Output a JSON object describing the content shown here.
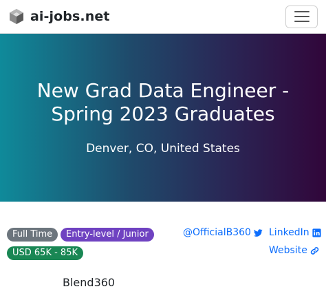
{
  "navbar": {
    "brand": "ai-jobs.net",
    "menu_icon": "hamburger-icon"
  },
  "hero": {
    "title": "New Grad Data Engineer - Spring 2023 Graduates",
    "location": "Denver, CO, United States"
  },
  "badges": {
    "employment_type": "Full Time",
    "level": "Entry-level / Junior",
    "salary": "USD 65K - 85K"
  },
  "links": {
    "twitter": "@OfficialB360",
    "linkedin": "LinkedIn",
    "website": "Website"
  },
  "company": {
    "name": "Blend360"
  },
  "colors": {
    "gradient_start": "#0f8a9a",
    "gradient_end": "#31063a",
    "badge_gray": "#6c757d",
    "badge_purple": "#6f42c1",
    "badge_green": "#198754",
    "link_blue": "#0d6efd"
  }
}
